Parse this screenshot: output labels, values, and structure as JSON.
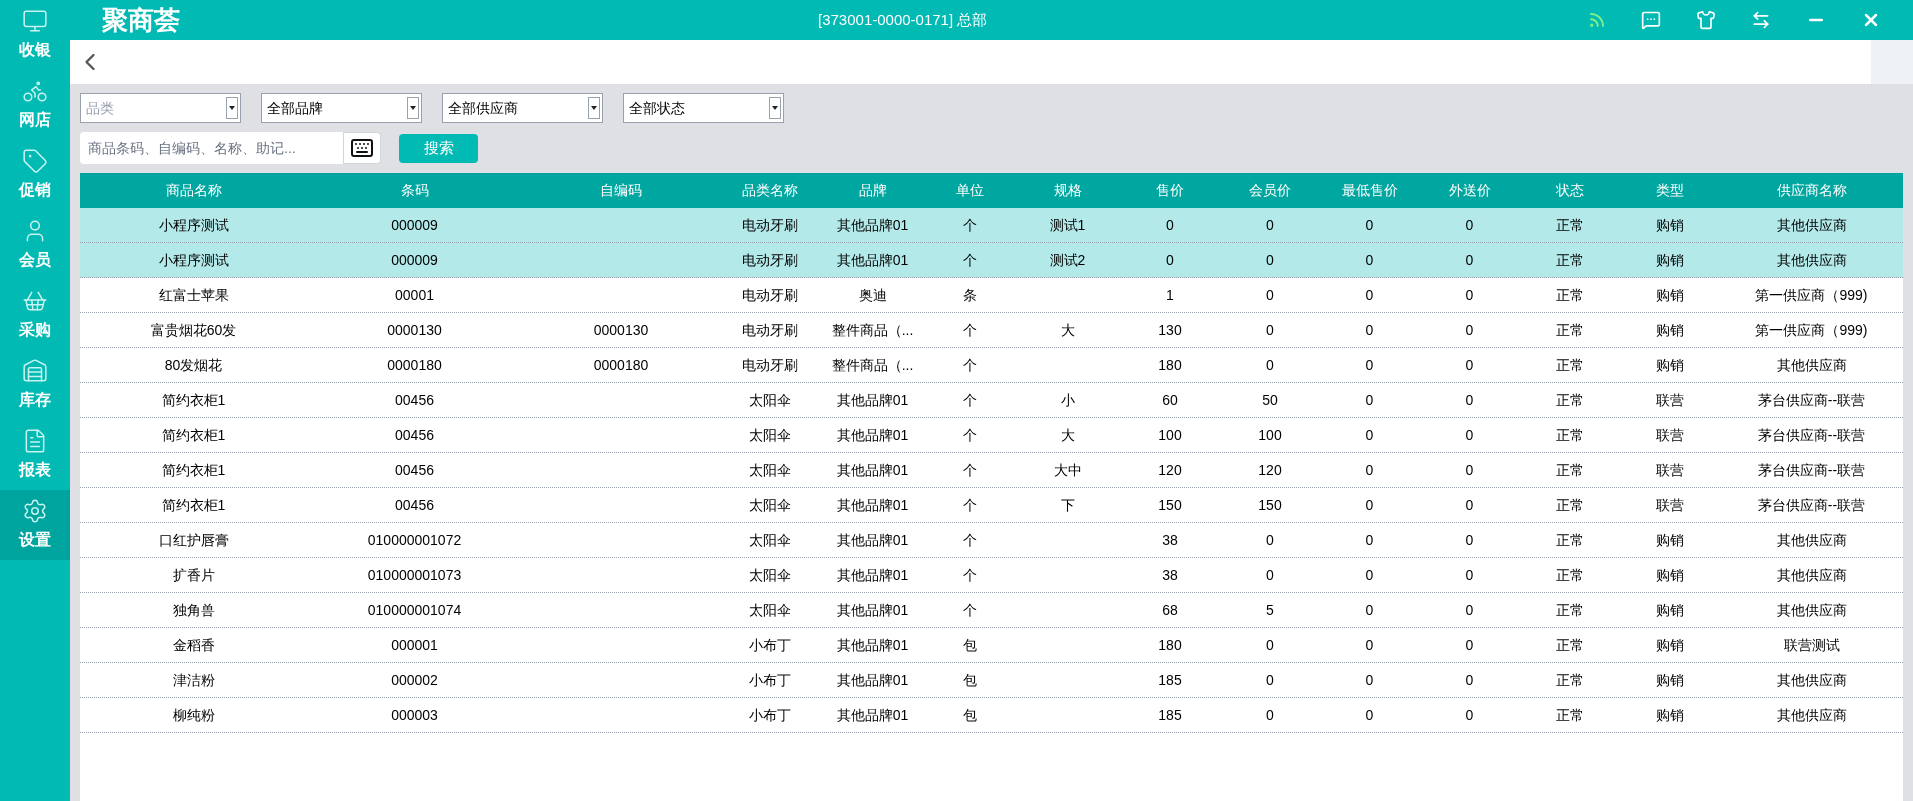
{
  "sidebar": {
    "items": [
      {
        "label": "收银",
        "kind": "monitor",
        "selected": false
      },
      {
        "label": "网店",
        "kind": "bike",
        "selected": false
      },
      {
        "label": "促销",
        "kind": "tag",
        "selected": false
      },
      {
        "label": "会员",
        "kind": "user",
        "selected": false
      },
      {
        "label": "采购",
        "kind": "basket",
        "selected": false
      },
      {
        "label": "库存",
        "kind": "warehouse",
        "selected": false
      },
      {
        "label": "报表",
        "kind": "file",
        "selected": false
      },
      {
        "label": "设置",
        "kind": "settings",
        "selected": true
      }
    ]
  },
  "header": {
    "logo": "聚商荟",
    "title": "[373001-0000-0171] 总部"
  },
  "filters": [
    {
      "placeholder": "品类"
    },
    {
      "value": "全部品牌"
    },
    {
      "value": "全部供应商"
    },
    {
      "value": "全部状态"
    }
  ],
  "search": {
    "placeholder": "商品条码、自编码、名称、助记...",
    "button": "搜索"
  },
  "table": {
    "columns": [
      "商品名称",
      "条码",
      "自编码",
      "品类名称",
      "品牌",
      "单位",
      "规格",
      "售价",
      "会员价",
      "最低售价",
      "外送价",
      "状态",
      "类型",
      "供应商名称"
    ],
    "rows": [
      {
        "selected": true,
        "cells": [
          "小程序测试",
          "000009",
          "",
          "电动牙刷",
          "其他品牌01",
          "个",
          "测试1",
          "0",
          "0",
          "0",
          "0",
          "正常",
          "购销",
          "其他供应商"
        ]
      },
      {
        "selected": true,
        "cells": [
          "小程序测试",
          "000009",
          "",
          "电动牙刷",
          "其他品牌01",
          "个",
          "测试2",
          "0",
          "0",
          "0",
          "0",
          "正常",
          "购销",
          "其他供应商"
        ]
      },
      {
        "selected": false,
        "cells": [
          "红富士苹果",
          "00001",
          "",
          "电动牙刷",
          "奥迪",
          "条",
          "",
          "1",
          "0",
          "0",
          "0",
          "正常",
          "购销",
          "第一供应商（999)"
        ]
      },
      {
        "selected": false,
        "cells": [
          "富贵烟花60发",
          "0000130",
          "0000130",
          "电动牙刷",
          "整件商品（...",
          "个",
          "大",
          "130",
          "0",
          "0",
          "0",
          "正常",
          "购销",
          "第一供应商（999)"
        ]
      },
      {
        "selected": false,
        "cells": [
          "80发烟花",
          "0000180",
          "0000180",
          "电动牙刷",
          "整件商品（...",
          "个",
          "",
          "180",
          "0",
          "0",
          "0",
          "正常",
          "购销",
          "其他供应商"
        ]
      },
      {
        "selected": false,
        "cells": [
          "简约衣柜1",
          "00456",
          "",
          "太阳伞",
          "其他品牌01",
          "个",
          "小",
          "60",
          "50",
          "0",
          "0",
          "正常",
          "联营",
          "茅台供应商--联营"
        ]
      },
      {
        "selected": false,
        "cells": [
          "简约衣柜1",
          "00456",
          "",
          "太阳伞",
          "其他品牌01",
          "个",
          "大",
          "100",
          "100",
          "0",
          "0",
          "正常",
          "联营",
          "茅台供应商--联营"
        ]
      },
      {
        "selected": false,
        "cells": [
          "简约衣柜1",
          "00456",
          "",
          "太阳伞",
          "其他品牌01",
          "个",
          "大中",
          "120",
          "120",
          "0",
          "0",
          "正常",
          "联营",
          "茅台供应商--联营"
        ]
      },
      {
        "selected": false,
        "cells": [
          "简约衣柜1",
          "00456",
          "",
          "太阳伞",
          "其他品牌01",
          "个",
          "下",
          "150",
          "150",
          "0",
          "0",
          "正常",
          "联营",
          "茅台供应商--联营"
        ]
      },
      {
        "selected": false,
        "cells": [
          "口红护唇膏",
          "010000001072",
          "",
          "太阳伞",
          "其他品牌01",
          "个",
          "",
          "38",
          "0",
          "0",
          "0",
          "正常",
          "购销",
          "其他供应商"
        ]
      },
      {
        "selected": false,
        "cells": [
          "扩香片",
          "010000001073",
          "",
          "太阳伞",
          "其他品牌01",
          "个",
          "",
          "38",
          "0",
          "0",
          "0",
          "正常",
          "购销",
          "其他供应商"
        ]
      },
      {
        "selected": false,
        "cells": [
          "独角兽",
          "010000001074",
          "",
          "太阳伞",
          "其他品牌01",
          "个",
          "",
          "68",
          "5",
          "0",
          "0",
          "正常",
          "购销",
          "其他供应商"
        ]
      },
      {
        "selected": false,
        "cells": [
          "金稻香",
          "000001",
          "",
          "小布丁",
          "其他品牌01",
          "包",
          "",
          "180",
          "0",
          "0",
          "0",
          "正常",
          "购销",
          "联营测试"
        ]
      },
      {
        "selected": false,
        "cells": [
          "津洁粉",
          "000002",
          "",
          "小布丁",
          "其他品牌01",
          "包",
          "",
          "185",
          "0",
          "0",
          "0",
          "正常",
          "购销",
          "其他供应商"
        ]
      },
      {
        "selected": false,
        "cells": [
          "柳纯粉",
          "000003",
          "",
          "小布丁",
          "其他品牌01",
          "包",
          "",
          "185",
          "0",
          "0",
          "0",
          "正常",
          "购销",
          "其他供应商"
        ]
      }
    ]
  }
}
